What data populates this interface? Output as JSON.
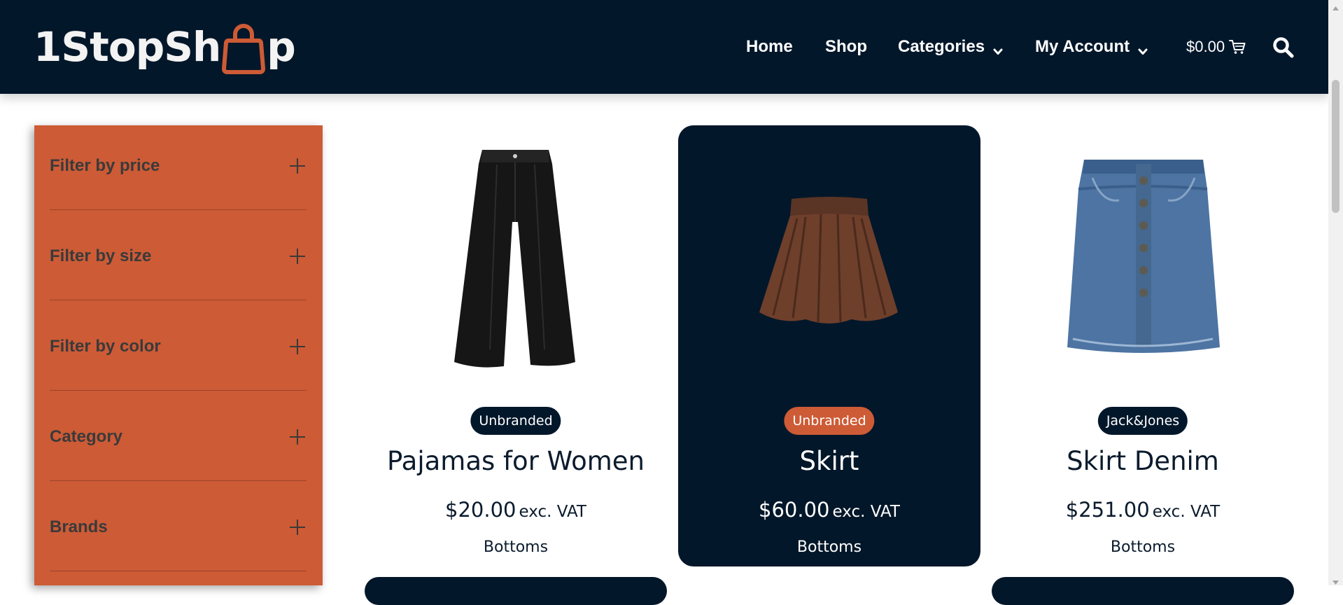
{
  "header": {
    "logo_text_left": "1StopSh",
    "logo_text_right": "p",
    "nav": {
      "home": "Home",
      "shop": "Shop",
      "categories": "Categories",
      "my_account": "My Account"
    },
    "cart_amount": "$0.00",
    "icons": {
      "logo": "shopping-bag-icon",
      "cart": "shopping-cart-icon",
      "search": "search-icon",
      "dropdown": "chevron-down-icon"
    }
  },
  "sidebar": {
    "filters": [
      {
        "label": "Filter by price"
      },
      {
        "label": "Filter by size"
      },
      {
        "label": "Filter by color"
      },
      {
        "label": "Category"
      },
      {
        "label": "Brands"
      }
    ],
    "expand_icon": "plus-icon"
  },
  "products": [
    {
      "brand": "Unbranded",
      "name": "Pajamas for Women",
      "price": "$20.00",
      "vat": "exc. VAT",
      "category": "Bottoms",
      "image": "black wide-leg trousers"
    },
    {
      "brand": "Unbranded",
      "name": "Skirt",
      "price": "$60.00",
      "vat": "exc. VAT",
      "category": "Bottoms",
      "image": "brown pleated skirt"
    },
    {
      "brand": "Jack&Jones",
      "name": "Skirt Denim",
      "price": "$251.00",
      "vat": "exc. VAT",
      "category": "Bottoms",
      "image": "blue denim skirt"
    }
  ],
  "colors": {
    "navy": "#03172a",
    "accent_orange": "#cd5b36",
    "white": "#ffffff"
  }
}
